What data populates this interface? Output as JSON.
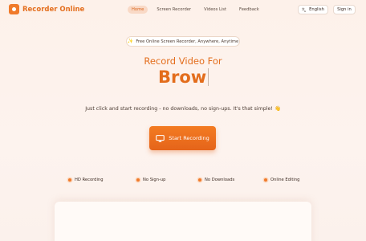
{
  "brand": {
    "name": "Recorder Online"
  },
  "nav": {
    "links": [
      {
        "label": "Home",
        "active": true
      },
      {
        "label": "Screen Recorder",
        "active": false
      },
      {
        "label": "Videos List",
        "active": false
      },
      {
        "label": "Feedback",
        "active": false
      }
    ],
    "language_label": "English",
    "signin_label": "Sign in"
  },
  "hero": {
    "pill_text": "Free Online Screen Recorder, Anywhere, Anytime",
    "headline_line1": "Record Video For",
    "headline_line2": "Brow",
    "subtitle": "Just click and start recording - no downloads, no sign-ups. It's that simple! 👋",
    "cta_label": "Start Recording"
  },
  "features": [
    {
      "label": "HD Recording"
    },
    {
      "label": "No Sign-up"
    },
    {
      "label": "No Downloads"
    },
    {
      "label": "Online Editing"
    }
  ],
  "colors": {
    "accent": "#f07a2a",
    "accent_dark": "#e36d1c"
  }
}
